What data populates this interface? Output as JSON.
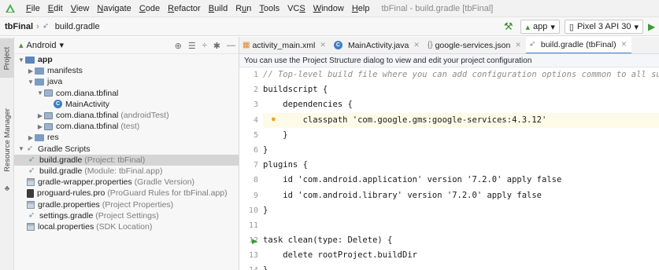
{
  "menu_bar": {
    "items": [
      {
        "label": "File",
        "u": "F"
      },
      {
        "label": "Edit",
        "u": "E"
      },
      {
        "label": "View",
        "u": "V"
      },
      {
        "label": "Navigate",
        "u": "N"
      },
      {
        "label": "Code",
        "u": "C"
      },
      {
        "label": "Refactor",
        "u": "R"
      },
      {
        "label": "Build",
        "u": "B"
      },
      {
        "label": "Run",
        "u": "u"
      },
      {
        "label": "Tools",
        "u": "T"
      },
      {
        "label": "VCS",
        "u": "S"
      },
      {
        "label": "Window",
        "u": "W"
      },
      {
        "label": "Help",
        "u": "H"
      }
    ],
    "window_title": "tbFinal - build.gradle [tbFinal]"
  },
  "nav_bar": {
    "project": "tbFinal",
    "file": "build.gradle",
    "run_config": "app",
    "device": "Pixel 3 API 30"
  },
  "left_strip": {
    "project_tab": "Project",
    "resource_tab": "Resource Manager"
  },
  "project_panel": {
    "view_label": "Android",
    "tree": [
      {
        "label": "app",
        "muted": ""
      },
      {
        "label": "manifests",
        "muted": ""
      },
      {
        "label": "java",
        "muted": ""
      },
      {
        "label": "com.diana.tbfinal",
        "muted": ""
      },
      {
        "label": "MainActivity",
        "muted": ""
      },
      {
        "label": "com.diana.tbfinal",
        "muted": "(androidTest)"
      },
      {
        "label": "com.diana.tbfinal",
        "muted": "(test)"
      },
      {
        "label": "res",
        "muted": ""
      },
      {
        "label": "Gradle Scripts",
        "muted": ""
      },
      {
        "label": "build.gradle",
        "muted": "(Project: tbFinal)"
      },
      {
        "label": "build.gradle",
        "muted": "(Module: tbFinal.app)"
      },
      {
        "label": "gradle-wrapper.properties",
        "muted": "(Gradle Version)"
      },
      {
        "label": "proguard-rules.pro",
        "muted": "(ProGuard Rules for tbFinal.app)"
      },
      {
        "label": "gradle.properties",
        "muted": "(Project Properties)"
      },
      {
        "label": "settings.gradle",
        "muted": "(Project Settings)"
      },
      {
        "label": "local.properties",
        "muted": "(SDK Location)"
      }
    ]
  },
  "editor": {
    "tabs": [
      {
        "label": "activity_main.xml",
        "icon": "layout-xml-icon"
      },
      {
        "label": "MainActivity.java",
        "icon": "java-class-icon"
      },
      {
        "label": "google-services.json",
        "icon": "json-file-icon"
      },
      {
        "label": "build.gradle (tbFinal)",
        "icon": "gradle-icon"
      }
    ],
    "notification": "You can use the Project Structure dialog to view and edit your project configuration",
    "code": [
      {
        "n": "1",
        "text": "// Top-level build file where you can add configuration options common to all sub-projec"
      },
      {
        "n": "2",
        "text": "buildscript {"
      },
      {
        "n": "3",
        "text": "    dependencies {"
      },
      {
        "n": "4",
        "text": "        classpath 'com.google.gms:google-services:4.3.12'"
      },
      {
        "n": "5",
        "text": "    }"
      },
      {
        "n": "6",
        "text": "}"
      },
      {
        "n": "7",
        "text": "plugins {"
      },
      {
        "n": "8",
        "text": "    id 'com.android.application' version '7.2.0' apply false"
      },
      {
        "n": "9",
        "text": "    id 'com.android.library' version '7.2.0' apply false"
      },
      {
        "n": "10",
        "text": "}"
      },
      {
        "n": "11",
        "text": ""
      },
      {
        "n": "12",
        "text": "task clean(type: Delete) {"
      },
      {
        "n": "13",
        "text": "    delete rootProject.buildDir"
      },
      {
        "n": "14",
        "text": "}"
      }
    ]
  }
}
